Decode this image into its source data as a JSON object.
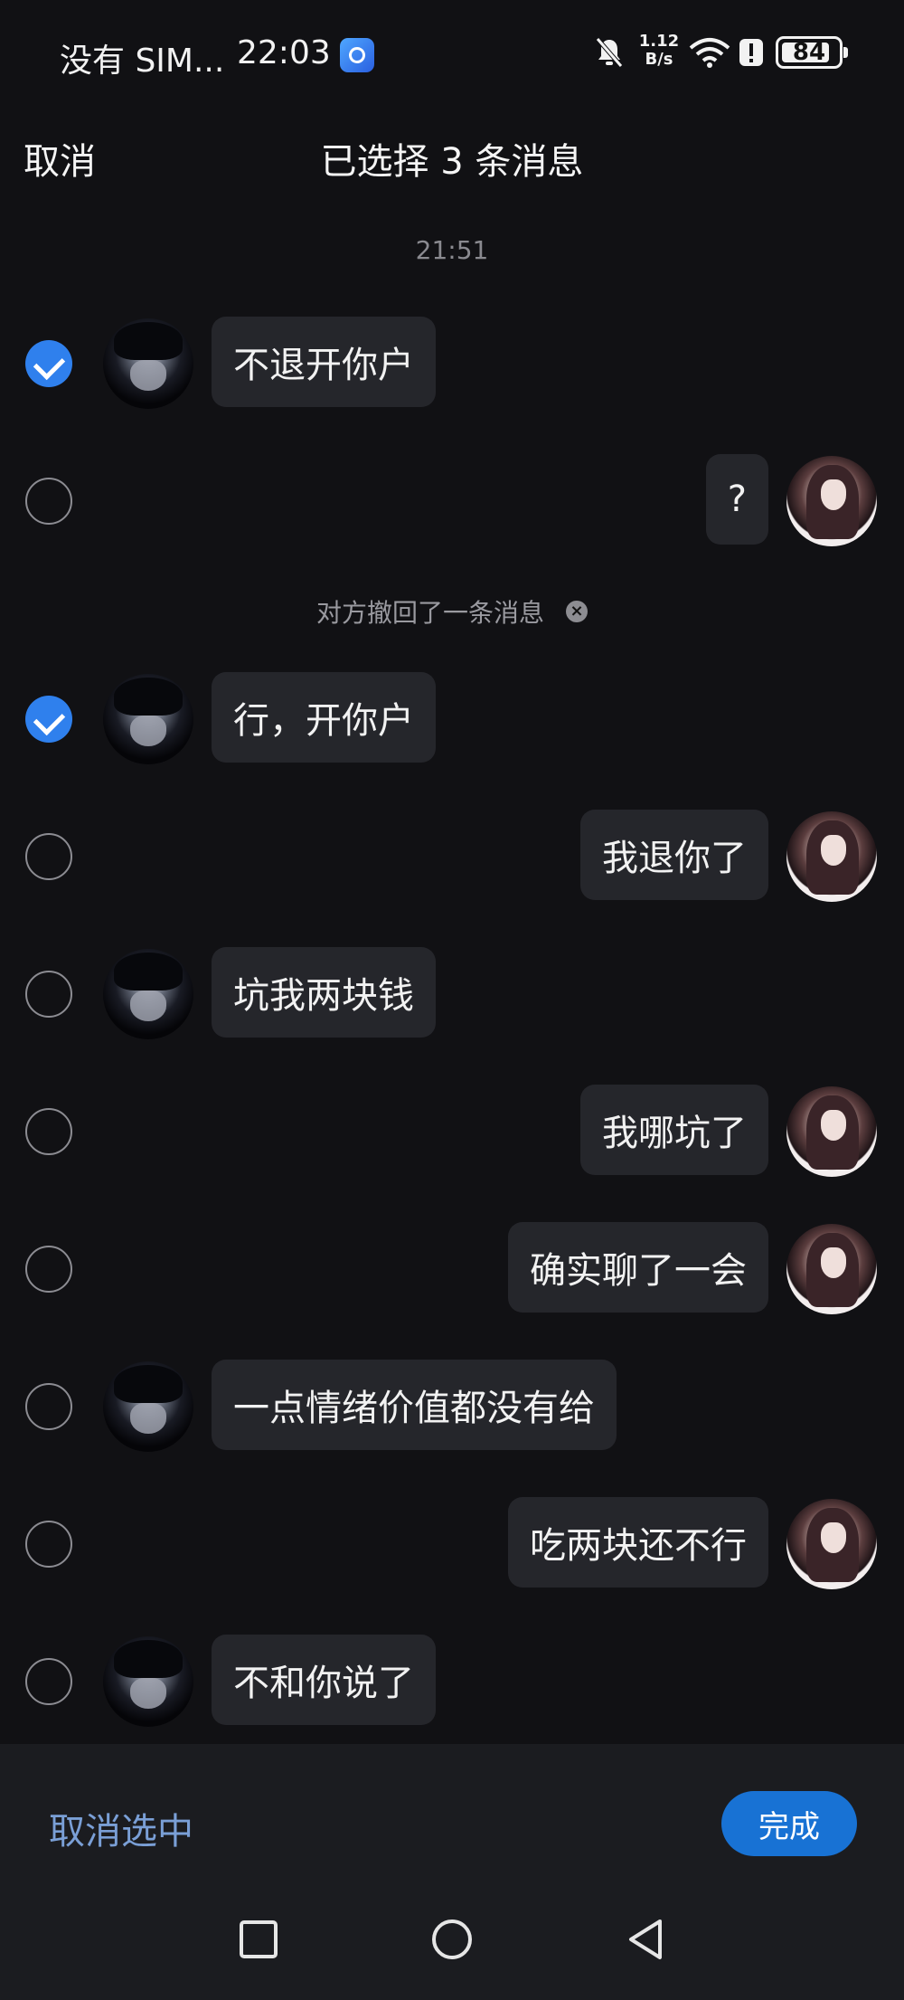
{
  "status_bar": {
    "carrier": "没有 SIM...",
    "time": "22:03",
    "net_speed_value": "1.12",
    "net_speed_unit": "B/s",
    "battery": "84",
    "battery_level": 0.84
  },
  "header": {
    "cancel": "取消",
    "title": "已选择 3 条消息"
  },
  "timestamp": "21:51",
  "recall_notice": "对方撤回了一条消息",
  "messages_top": [
    {
      "text": "不退开你户",
      "side": "left",
      "selected": true
    },
    {
      "text": "?",
      "side": "right",
      "selected": false
    }
  ],
  "messages": [
    {
      "text": "行，开你户",
      "side": "left",
      "selected": true
    },
    {
      "text": "我退你了",
      "side": "right",
      "selected": false
    },
    {
      "text": "坑我两块钱",
      "side": "left",
      "selected": false
    },
    {
      "text": "我哪坑了",
      "side": "right",
      "selected": false
    },
    {
      "text": "确实聊了一会",
      "side": "right",
      "selected": false
    },
    {
      "text": "一点情绪价值都没有给",
      "side": "left",
      "selected": false
    },
    {
      "text": "吃两块还不行",
      "side": "right",
      "selected": false
    },
    {
      "text": "不和你说了",
      "side": "left",
      "selected": false
    }
  ],
  "bottom": {
    "deselect": "取消选中",
    "done": "完成"
  },
  "navbar": {
    "icons": [
      "recents-square-icon",
      "home-circle-icon",
      "back-triangle-icon"
    ]
  }
}
